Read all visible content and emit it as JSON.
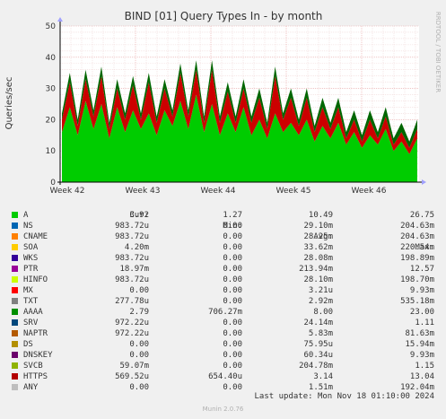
{
  "chart_data": {
    "type": "area",
    "title": "BIND [01] Query Types In - by month",
    "ylabel": "Queries/sec",
    "watermark": "RRDTOOL / TOBI OETIKER",
    "ylim": [
      0,
      50
    ],
    "yticks": [
      "0",
      "10",
      "20",
      "30",
      "40",
      "50"
    ],
    "xticks": [
      "Week 42",
      "Week 43",
      "Week 44",
      "Week 45",
      "Week 46"
    ],
    "grid": true,
    "series": [
      {
        "name": "A",
        "color": "#00cc00",
        "values": [
          16,
          24,
          15,
          26,
          17,
          25,
          14,
          24,
          16,
          23,
          17,
          22,
          15,
          23,
          18,
          26,
          17,
          28,
          16,
          25,
          15,
          22,
          16,
          24,
          15,
          20,
          14,
          22,
          16,
          19,
          15,
          20,
          13,
          18,
          14,
          19,
          12,
          16,
          11,
          15,
          12,
          17,
          10,
          13,
          9,
          14
        ]
      },
      {
        "name": "HTTPS",
        "color": "#cc0000",
        "values": [
          4,
          8,
          3,
          7,
          4,
          9,
          3,
          6,
          4,
          8,
          3,
          10,
          4,
          7,
          3,
          9,
          4,
          8,
          3,
          11,
          4,
          7,
          3,
          6,
          4,
          7,
          3,
          12,
          4,
          8,
          3,
          7,
          3,
          6,
          3,
          5,
          2,
          4,
          2,
          5,
          2,
          4,
          2,
          3,
          2,
          3
        ]
      },
      {
        "name": "AAAA",
        "color": "#006600",
        "values": [
          2,
          3,
          2,
          3,
          2,
          3,
          2,
          3,
          2,
          3,
          2,
          3,
          2,
          3,
          2,
          3,
          2,
          3,
          2,
          3,
          2,
          3,
          2,
          3,
          2,
          3,
          2,
          3,
          2,
          3,
          2,
          3,
          2,
          3,
          2,
          3,
          2,
          3,
          2,
          3,
          2,
          3,
          2,
          3,
          2,
          3
        ]
      }
    ]
  },
  "legend": {
    "headers": {
      "cur": "Cur:",
      "min": "Min:",
      "avg": "Avg:",
      "max": "Max:"
    },
    "rows": [
      {
        "name": "A",
        "color": "#00cc00",
        "cur": "3.92",
        "min": "1.27",
        "avg": "10.49",
        "max": "26.75"
      },
      {
        "name": "NS",
        "color": "#0066b3",
        "cur": "983.72u",
        "min": "0.00",
        "avg": "29.10m",
        "max": "204.63m"
      },
      {
        "name": "CNAME",
        "color": "#ff8000",
        "cur": "983.72u",
        "min": "0.00",
        "avg": "28.25m",
        "max": "204.63m"
      },
      {
        "name": "SOA",
        "color": "#ffcc00",
        "cur": "4.20m",
        "min": "0.00",
        "avg": "33.62m",
        "max": "220.54m"
      },
      {
        "name": "WKS",
        "color": "#330099",
        "cur": "983.72u",
        "min": "0.00",
        "avg": "28.08m",
        "max": "198.89m"
      },
      {
        "name": "PTR",
        "color": "#990099",
        "cur": "18.97m",
        "min": "0.00",
        "avg": "213.94m",
        "max": "12.57"
      },
      {
        "name": "HINFO",
        "color": "#ccff00",
        "cur": "983.72u",
        "min": "0.00",
        "avg": "28.10m",
        "max": "198.70m"
      },
      {
        "name": "MX",
        "color": "#ff0000",
        "cur": "0.00",
        "min": "0.00",
        "avg": "3.21u",
        "max": "9.93m"
      },
      {
        "name": "TXT",
        "color": "#808080",
        "cur": "277.78u",
        "min": "0.00",
        "avg": "2.92m",
        "max": "535.18m"
      },
      {
        "name": "AAAA",
        "color": "#008f00",
        "cur": "2.79",
        "min": "706.27m",
        "avg": "8.00",
        "max": "23.00"
      },
      {
        "name": "SRV",
        "color": "#00487d",
        "cur": "972.22u",
        "min": "0.00",
        "avg": "24.14m",
        "max": "1.11"
      },
      {
        "name": "NAPTR",
        "color": "#b35a00",
        "cur": "972.22u",
        "min": "0.00",
        "avg": "5.83m",
        "max": "81.63m"
      },
      {
        "name": "DS",
        "color": "#b38f00",
        "cur": "0.00",
        "min": "0.00",
        "avg": "75.95u",
        "max": "15.94m"
      },
      {
        "name": "DNSKEY",
        "color": "#6b006b",
        "cur": "0.00",
        "min": "0.00",
        "avg": "60.34u",
        "max": "9.93m"
      },
      {
        "name": "SVCB",
        "color": "#8fb300",
        "cur": "59.07m",
        "min": "0.00",
        "avg": "204.78m",
        "max": "1.15"
      },
      {
        "name": "HTTPS",
        "color": "#b30000",
        "cur": "569.52u",
        "min": "654.40u",
        "avg": "3.14",
        "max": "13.04"
      },
      {
        "name": "ANY",
        "color": "#bebebe",
        "cur": "0.00",
        "min": "0.00",
        "avg": "1.51m",
        "max": "192.04m"
      }
    ]
  },
  "last_update": "Last update:  Mon Nov 18 01:10:00 2024",
  "footer": "Munin 2.0.76"
}
